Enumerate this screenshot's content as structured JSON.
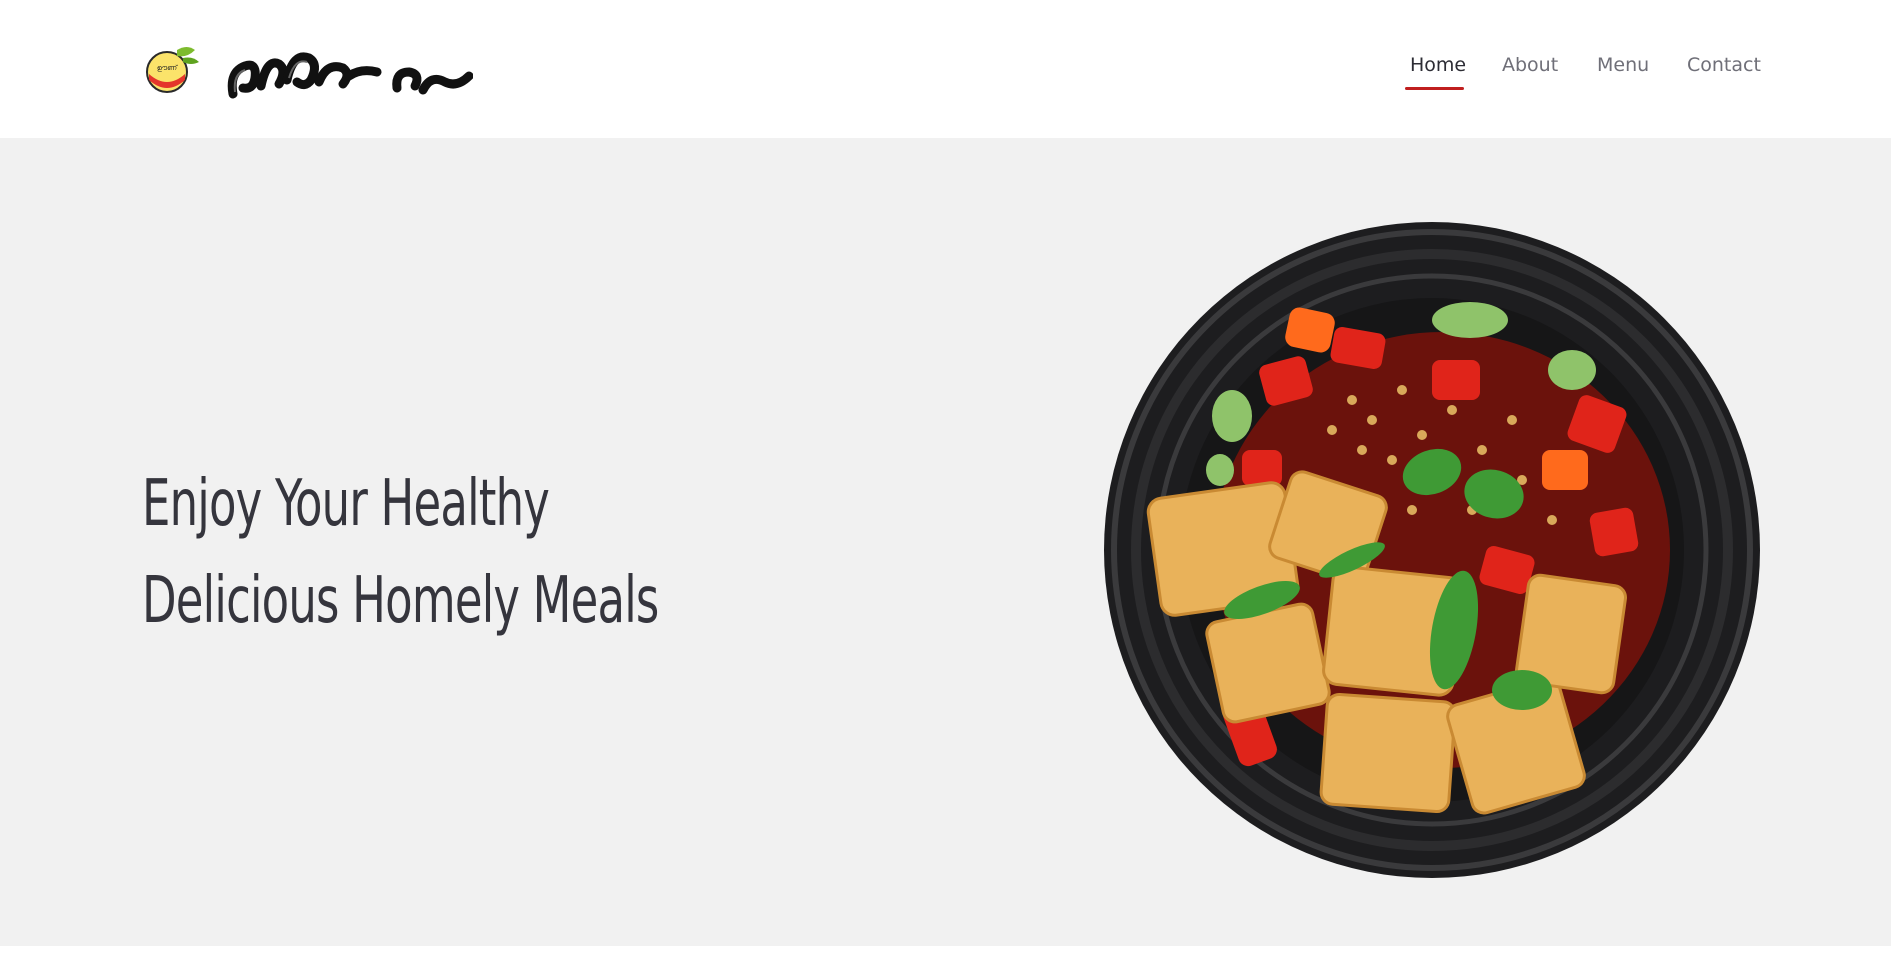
{
  "brand": {
    "logo_text": "വീട്ടിലെ ഊണ്",
    "badge_text": "വീട്ടിലെ ഊണ്"
  },
  "nav": {
    "items": [
      {
        "label": "Home",
        "active": true
      },
      {
        "label": "About",
        "active": false
      },
      {
        "label": "Menu",
        "active": false
      },
      {
        "label": "Contact",
        "active": false
      }
    ]
  },
  "hero": {
    "title_line1": "Enjoy Your Healthy",
    "title_line2": "Delicious Homely Meals",
    "image_subject": "tofu-stir-fry-plate"
  },
  "colors": {
    "accent": "#c01f1f",
    "hero_bg": "#f1f1f1",
    "nav_text": "#6f6f78",
    "nav_active": "#2c2c34",
    "title": "#35353d"
  },
  "icons": {
    "logo_badge": "brand-badge-icon"
  }
}
